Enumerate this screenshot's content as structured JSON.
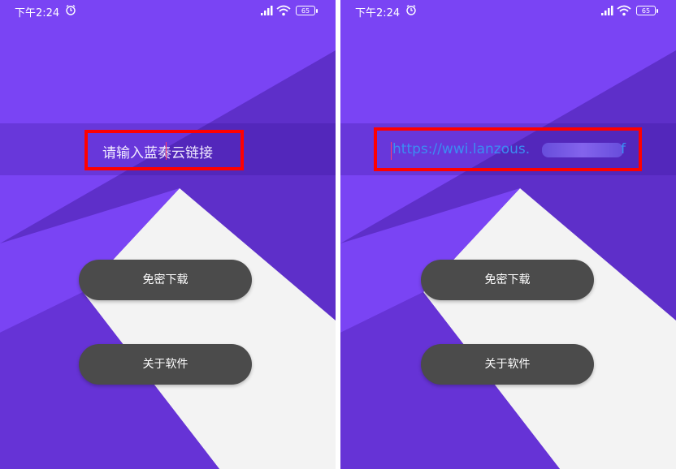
{
  "colors": {
    "background_purple": "#7a44f4",
    "dark_purple": "#5e2fc9",
    "light_panel": "#f3f3f3",
    "button": "#4b4b4b",
    "highlight": "#ff0000",
    "url_text": "#3b8df2"
  },
  "status_bar": {
    "time": "下午2:24",
    "alarm_icon": "alarm-clock-icon",
    "signal_icon": "signal-icon",
    "wifi_icon": "wifi-icon",
    "battery": "65"
  },
  "screens": {
    "left": {
      "input_placeholder": "请输入蓝奏云链接",
      "download_button": "免密下载",
      "about_button": "关于软件"
    },
    "right": {
      "input_value": "https://wwi.lanzous.",
      "input_value_suffix": "f",
      "download_button": "免密下载",
      "about_button": "关于软件"
    }
  }
}
